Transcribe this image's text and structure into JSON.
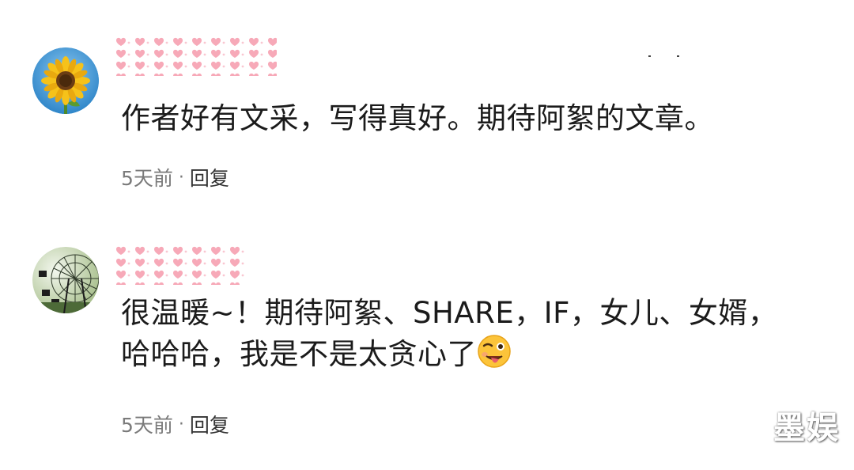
{
  "comments": [
    {
      "avatar": "sunflower-avatar",
      "text_lines": [
        "作者好有文采，写得真好。期待阿絮的文章。"
      ],
      "time": "5天前",
      "separator": "·",
      "reply_label": "回复"
    },
    {
      "avatar": "ferris-wheel-avatar",
      "text_lines": [
        "很温暖~！期待阿絮、SHARE，IF，女儿、女婿，",
        "哈哈哈，我是不是太贪心了"
      ],
      "emoji": "winking-tongue-emoji",
      "time": "5天前",
      "separator": "·",
      "reply_label": "回复"
    }
  ],
  "watermark": "墨娱",
  "colors": {
    "redact_heart": "#f7a9b8",
    "meta_gray": "#7a7a7a",
    "text": "#1b1b1b"
  }
}
